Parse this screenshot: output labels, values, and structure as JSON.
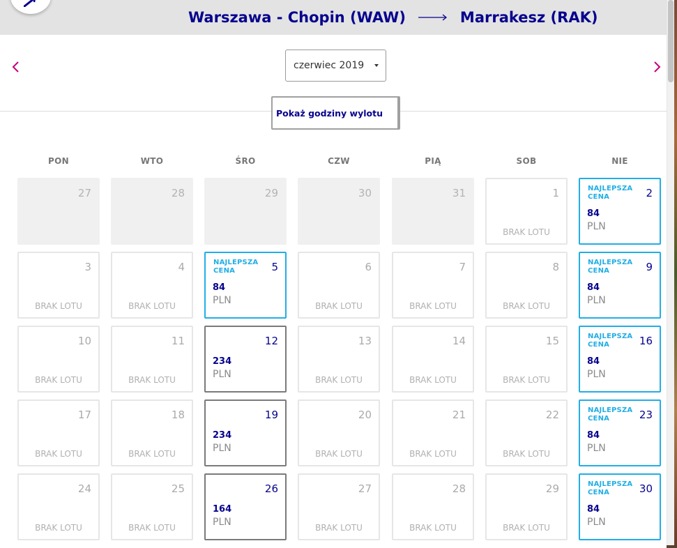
{
  "header": {
    "origin": "Warszawa - Chopin (WAW)",
    "destination": "Marrakesz (RAK)"
  },
  "controls": {
    "month_select_value": "czerwiec 2019",
    "show_hours_label": "Pokaż godziny wylotu"
  },
  "calendar": {
    "weekdays": [
      "PON",
      "WTO",
      "ŚRO",
      "CZW",
      "PIĄ",
      "SOB",
      "NIE"
    ],
    "best_price_label": "NAJLEPSZA CENA",
    "no_flight_label": "BRAK LOTU",
    "currency": "PLN",
    "days": [
      {
        "day": "27",
        "type": "prev"
      },
      {
        "day": "28",
        "type": "prev"
      },
      {
        "day": "29",
        "type": "prev"
      },
      {
        "day": "30",
        "type": "prev"
      },
      {
        "day": "31",
        "type": "prev"
      },
      {
        "day": "1",
        "type": "none"
      },
      {
        "day": "2",
        "type": "best",
        "price": "84"
      },
      {
        "day": "3",
        "type": "none"
      },
      {
        "day": "4",
        "type": "none"
      },
      {
        "day": "5",
        "type": "best",
        "price": "84"
      },
      {
        "day": "6",
        "type": "none"
      },
      {
        "day": "7",
        "type": "none"
      },
      {
        "day": "8",
        "type": "none"
      },
      {
        "day": "9",
        "type": "best",
        "price": "84"
      },
      {
        "day": "10",
        "type": "none"
      },
      {
        "day": "11",
        "type": "none"
      },
      {
        "day": "12",
        "type": "available",
        "price": "234"
      },
      {
        "day": "13",
        "type": "none"
      },
      {
        "day": "14",
        "type": "none"
      },
      {
        "day": "15",
        "type": "none"
      },
      {
        "day": "16",
        "type": "best",
        "price": "84"
      },
      {
        "day": "17",
        "type": "none"
      },
      {
        "day": "18",
        "type": "none"
      },
      {
        "day": "19",
        "type": "available",
        "price": "234"
      },
      {
        "day": "20",
        "type": "none"
      },
      {
        "day": "21",
        "type": "none"
      },
      {
        "day": "22",
        "type": "none"
      },
      {
        "day": "23",
        "type": "best",
        "price": "84"
      },
      {
        "day": "24",
        "type": "none"
      },
      {
        "day": "25",
        "type": "none"
      },
      {
        "day": "26",
        "type": "available",
        "price": "164"
      },
      {
        "day": "27",
        "type": "none"
      },
      {
        "day": "28",
        "type": "none"
      },
      {
        "day": "29",
        "type": "none"
      },
      {
        "day": "30",
        "type": "best",
        "price": "84"
      }
    ]
  },
  "icons": {
    "prev": "chevron-left-icon",
    "next": "chevron-right-icon",
    "route": "long-arrow-right-icon",
    "caret": "caret-down-icon",
    "logo": "airline-logo-icon"
  },
  "colors": {
    "brand": "#06038d",
    "accent": "#21aee5",
    "nav": "#c6007e"
  }
}
